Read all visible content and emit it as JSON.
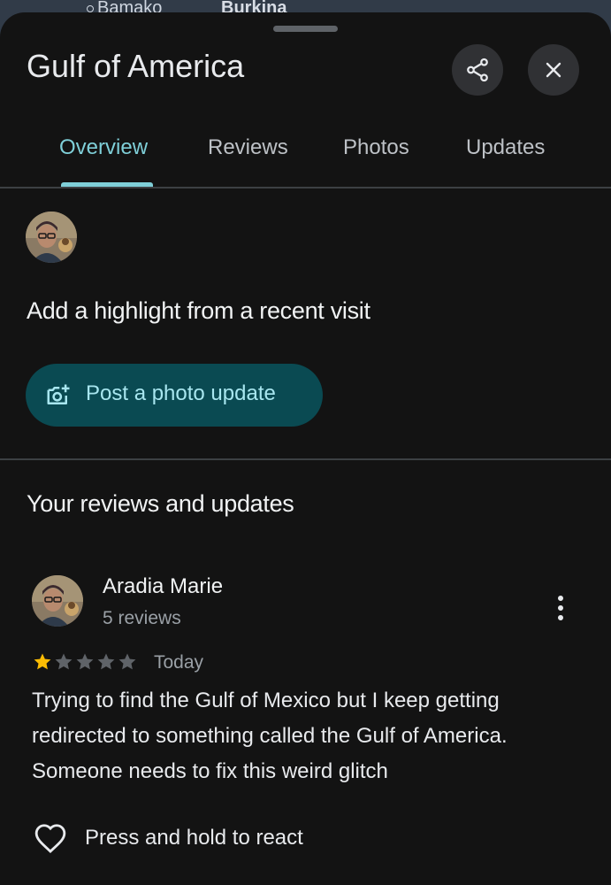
{
  "map": {
    "city_label": "Bamako",
    "country_label": "Burkina"
  },
  "place": {
    "title": "Gulf of America"
  },
  "tabs": [
    {
      "label": "Overview",
      "active": true
    },
    {
      "label": "Reviews",
      "active": false
    },
    {
      "label": "Photos",
      "active": false
    },
    {
      "label": "Updates",
      "active": false
    }
  ],
  "highlight": {
    "title": "Add a highlight from a recent visit",
    "button_label": "Post a photo update",
    "button_icon": "add-photo-icon"
  },
  "your_reviews": {
    "section_title": "Your reviews and updates",
    "review": {
      "author": "Aradia Marie",
      "author_reviews": "5 reviews",
      "rating": 1,
      "max_rating": 5,
      "date": "Today",
      "text": "Trying to find the Gulf of Mexico but I keep getting redirected to something called the Gulf of America. Someone needs to fix this weird glitch",
      "react_label": "Press and hold to react"
    }
  },
  "colors": {
    "accent": "#7fcfd8",
    "button_bg": "#0a4a52",
    "background": "#131313",
    "star_filled": "#fbbc04",
    "star_empty": "#5f6368"
  }
}
